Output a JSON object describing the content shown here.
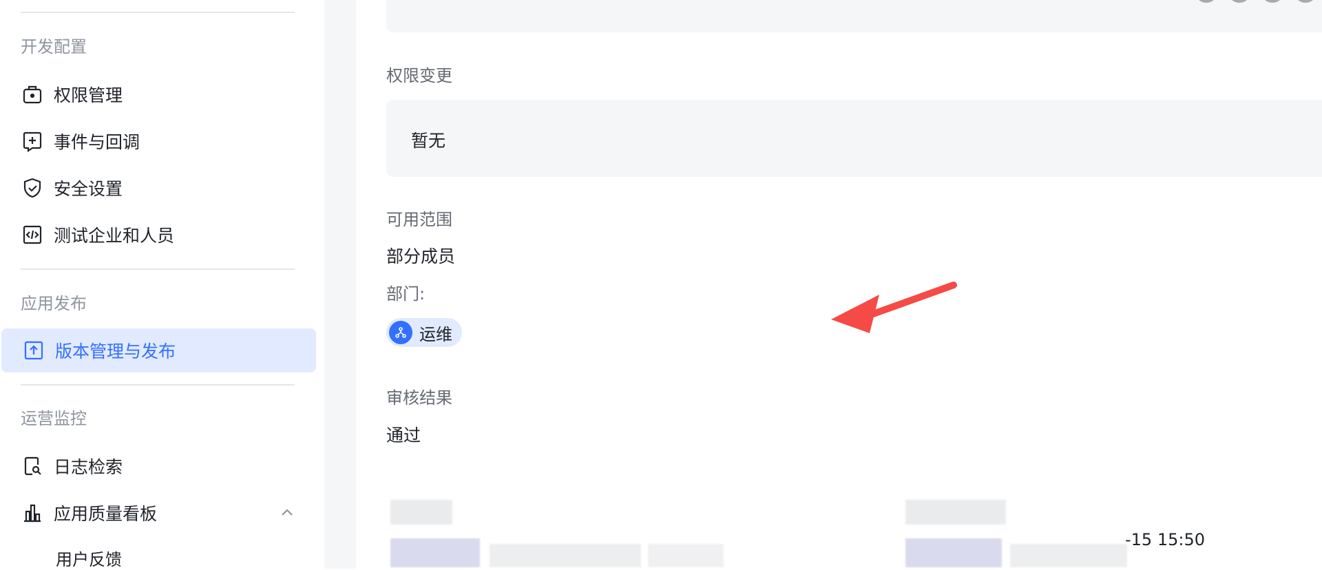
{
  "sidebar": {
    "sections": [
      {
        "label": "开发配置",
        "items": [
          {
            "label": "权限管理",
            "icon": "briefcase-lock-icon"
          },
          {
            "label": "事件与回调",
            "icon": "plus-square-icon"
          },
          {
            "label": "安全设置",
            "icon": "shield-check-icon"
          },
          {
            "label": "测试企业和人员",
            "icon": "code-square-icon"
          }
        ]
      },
      {
        "label": "应用发布",
        "items": [
          {
            "label": "版本管理与发布",
            "icon": "upload-square-icon",
            "active": true
          }
        ]
      },
      {
        "label": "运营监控",
        "items": [
          {
            "label": "日志检索",
            "icon": "doc-search-icon"
          },
          {
            "label": "应用质量看板",
            "icon": "bar-chart-icon",
            "expanded": true
          }
        ],
        "sub_items": [
          "用户反馈"
        ]
      }
    ]
  },
  "main": {
    "permission_change": {
      "label": "权限变更",
      "value": "暂无"
    },
    "scope": {
      "label": "可用范围",
      "value": "部分成员",
      "department_label": "部门:",
      "department_tag": "运维"
    },
    "review": {
      "label": "审核结果",
      "value": "通过"
    },
    "timestamp_partial": "-15 15:50"
  },
  "colors": {
    "accent": "#3370ff",
    "active_bg": "#e1eaff",
    "arrow": "#f54a45"
  }
}
